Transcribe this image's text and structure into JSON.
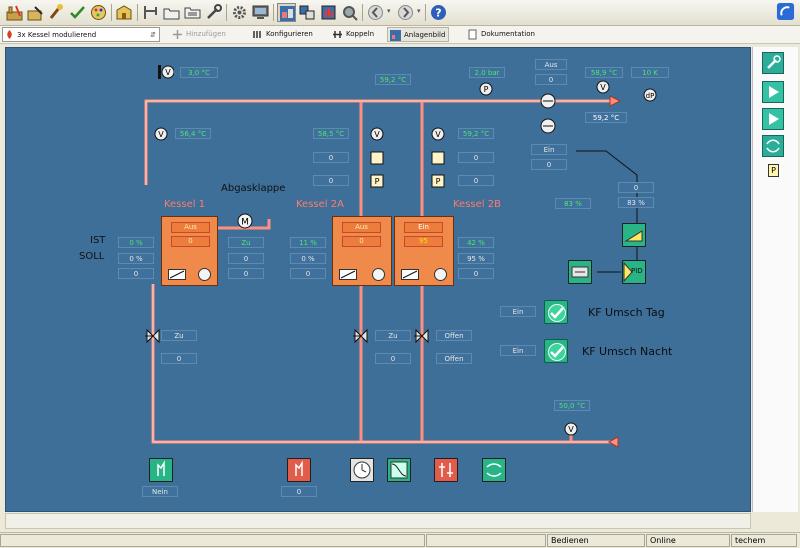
{
  "toolbar": {
    "buttons": [
      "factory-icon",
      "edit-plant-icon",
      "brush-icon",
      "check-icon",
      "palette-icon",
      "building-icon",
      "pipe-icon",
      "folder-icon",
      "folder-tree-icon",
      "tools-icon",
      "gear-icon",
      "monitor-icon",
      "plant-view-icon",
      "compare-icon",
      "hand-icon",
      "search-gear-icon",
      "back-icon",
      "forward-icon",
      "help-icon",
      "app-logo-icon"
    ]
  },
  "bar2": {
    "selector_value": "3x Kessel modulierend",
    "add_label": "Hinzufügen",
    "configure_label": "Konfigurieren",
    "couple_label": "Koppeln",
    "plant_label": "Anlagenbild",
    "doc_label": "Dokumentation"
  },
  "plant": {
    "top": {
      "outdoor_temp": "3,0 °C",
      "supply_temp": "59,2 °C",
      "pressure_value": "2,0 bar",
      "pump_state": "Aus",
      "pump_value": "0",
      "flow_temp": "58,9 °C",
      "flow_temp2": "10 K",
      "flow_temp_readout": "59,2 °C"
    },
    "boiler1": {
      "label": "Kessel 1",
      "temp": "56,4 °C",
      "state": "Aus",
      "value": "0",
      "ist": "0 %",
      "soll": "0 %",
      "extra": "0",
      "valve_state": "Zu",
      "valve_value": "0",
      "valve_small": "Zu"
    },
    "boiler2a": {
      "label": "Kessel 2A",
      "temp": "58,5 °C",
      "v1": "0",
      "v2": "0",
      "state": "Aus",
      "value": "0",
      "ist": "11 %",
      "soll": "0 %",
      "extra": "0",
      "valve_state": "Zu",
      "valve_value": "0"
    },
    "boiler2b": {
      "label": "Kessel 2B",
      "temp": "59,2 °C",
      "v1": "0",
      "v2": "0",
      "state": "Ein",
      "value": "95",
      "ist": "42 %",
      "soll": "95 %",
      "extra": "0",
      "valve_state": "Offen",
      "valve_value": "Offen"
    },
    "flap_label": "Abgasklappe",
    "ist_label": "IST",
    "soll_label": "SOLL",
    "pid": {
      "ein_state": "Ein",
      "ein_value": "0",
      "out_value": "0",
      "pct": "83 %",
      "left_pct": "83 %",
      "label": "PID"
    },
    "kf_tag": {
      "state": "Ein",
      "label": "KF Umsch Tag"
    },
    "kf_nacht": {
      "state": "Ein",
      "label": "KF Umsch Nacht"
    },
    "return_temp": "50,0 °C",
    "bottom": {
      "left_value": "Nein",
      "mid_value": "0"
    }
  },
  "status": {
    "mode": "Bedienen",
    "online": "Online",
    "user": "techem"
  },
  "colors": {
    "canvas": "#3d6f99",
    "pipe": "#ff8f7f",
    "boiler": "#f08a4a",
    "green_value": "#4ee66c"
  }
}
